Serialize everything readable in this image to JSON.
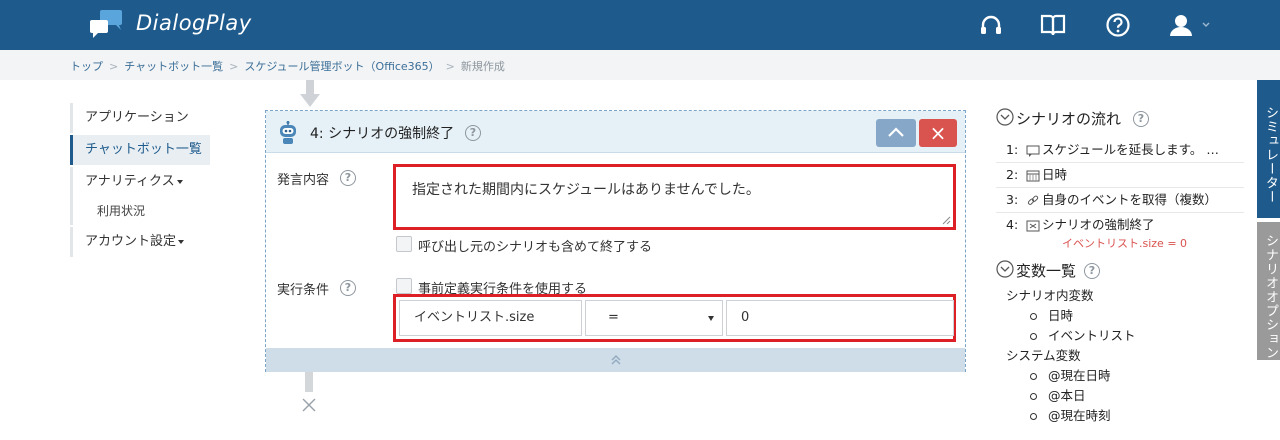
{
  "app": {
    "brand": "DialogPlay"
  },
  "header_icons": [
    "headset-icon",
    "book-icon",
    "help-icon",
    "user-icon"
  ],
  "breadcrumb": [
    {
      "label": "トップ"
    },
    {
      "label": "チャットボット一覧"
    },
    {
      "label": "スケジュール管理ボット（Office365）"
    },
    {
      "label": "新規作成"
    }
  ],
  "nav": {
    "application": "アプリケーション",
    "chatbot_list": "チャットボット一覧",
    "analytics": "アナリティクス",
    "usage": "利用状況",
    "account": "アカウント設定"
  },
  "card": {
    "title": "4: シナリオの強制終了",
    "close_glyph": "×",
    "utterance_label": "発言内容",
    "utterance_value": "指定された期間内にスケジュールはありませんでした。",
    "end_caller_label": "呼び出し元のシナリオも含めて終了する",
    "condition_label": "実行条件",
    "use_predefined_label": "事前定義実行条件を使用する",
    "condition_variable": "イベントリスト.size",
    "condition_operator": "=",
    "condition_value": "0"
  },
  "right_panel": {
    "flow_title": "シナリオの流れ",
    "steps": [
      {
        "num": "1:",
        "label": "スケジュールを延長します。 …"
      },
      {
        "num": "2:",
        "label": "日時"
      },
      {
        "num": "3:",
        "label": "自身のイベントを取得（複数）"
      },
      {
        "num": "4:",
        "label": "シナリオの強制終了",
        "note": "イベントリスト.size = 0"
      }
    ],
    "vars_title": "変数一覧",
    "scenario_vars_label": "シナリオ内変数",
    "scenario_vars": [
      "日時",
      "イベントリスト"
    ],
    "system_vars_label": "システム変数",
    "system_vars": [
      "@現在日時",
      "@本日",
      "@現在時刻"
    ]
  },
  "side_tabs": {
    "simulator": "シミュレーター",
    "options": "シナリオオプション"
  },
  "colors": {
    "header": "#1e5b8c",
    "danger": "#d9534f",
    "highlight": "#dd1f26",
    "panel": "#e6f0f7"
  }
}
